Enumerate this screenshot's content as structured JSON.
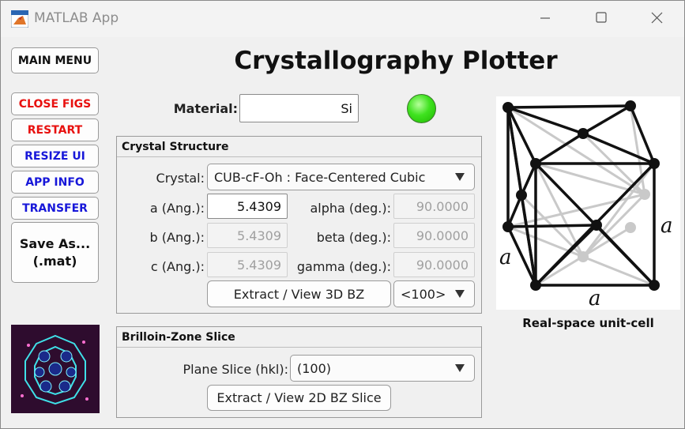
{
  "window": {
    "title": "MATLAB App"
  },
  "app_title": "Crystallography Plotter",
  "left_buttons": {
    "main_menu": "MAIN MENU",
    "close_figs": "CLOSE FIGS",
    "restart": "RESTART",
    "resize_ui": "RESIZE UI",
    "app_info": "APP INFO",
    "transfer": "TRANSFER",
    "save_as_line1": "Save As...",
    "save_as_line2": "(.mat)"
  },
  "material": {
    "label": "Material:",
    "value": "Si",
    "status_color": "#3fe21f"
  },
  "crystal_structure": {
    "title": "Crystal Structure",
    "crystal_label": "Crystal:",
    "crystal_value": "CUB-cF-Oh : Face-Centered Cubic",
    "a_label": "a (Ang.):",
    "a_value": "5.4309",
    "b_label": "b (Ang.):",
    "b_value": "5.4309",
    "c_label": "c (Ang.):",
    "c_value": "5.4309",
    "alpha_label": "alpha (deg.):",
    "alpha_value": "90.0000",
    "beta_label": "beta (deg.):",
    "beta_value": "90.0000",
    "gamma_label": "gamma (deg.):",
    "gamma_value": "90.0000",
    "extract_3d_label": "Extract / View 3D BZ",
    "direction_value": "<100>"
  },
  "bz_slice": {
    "title": "Brilloin-Zone Slice",
    "plane_label": "Plane Slice (hkl):",
    "plane_value": "(100)",
    "extract_2d_label": "Extract / View 2D BZ Slice"
  },
  "unit_cell": {
    "caption": "Real-space unit-cell",
    "edge_label_left": "a",
    "edge_label_right": "a",
    "edge_label_bottom": "a"
  }
}
